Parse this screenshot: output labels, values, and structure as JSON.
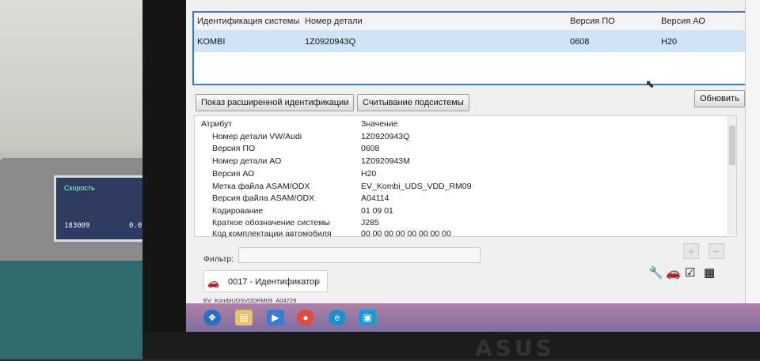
{
  "table": {
    "headers": [
      "Идентификация системы",
      "Номер детали",
      "Версия ПО",
      "Версия АО"
    ],
    "row": [
      "KOMBI",
      "1Z0920943Q",
      "0608",
      "H20"
    ]
  },
  "buttons": {
    "extended": "Показ расширенной идентификации",
    "subsystem": "Считывание подсистемы",
    "refresh": "Обновить"
  },
  "attributes": {
    "header_attr": "Атрибут",
    "header_value": "Значение",
    "rows": [
      {
        "k": "Номер детали VW/Audi",
        "v": "1Z0920943Q"
      },
      {
        "k": "Версия ПО",
        "v": "0608"
      },
      {
        "k": "Номер детали АО",
        "v": "1Z0920943M"
      },
      {
        "k": "Версия АО",
        "v": "H20"
      },
      {
        "k": "Метка файла ASAM/ODX",
        "v": "EV_Kombi_UDS_VDD_RM09"
      },
      {
        "k": "Версия файла ASAM/ODX",
        "v": "A04114"
      },
      {
        "k": "Кодирование",
        "v": "01 09 01"
      },
      {
        "k": "Краткое обозначение системы",
        "v": "J285"
      },
      {
        "k": "Код комплектации автомобиля",
        "v": "00 00 00 00 00 00 00 00"
      }
    ]
  },
  "filter": {
    "label": "Фильтр:"
  },
  "tab": {
    "label": "0017 - Идентификатор"
  },
  "status": {
    "text": "EV_KombiUDSVDDRM09_A04729"
  },
  "dash": {
    "label": "Скорость",
    "reading": "183009",
    "reading2": "0.0"
  },
  "brand": "ASUS"
}
